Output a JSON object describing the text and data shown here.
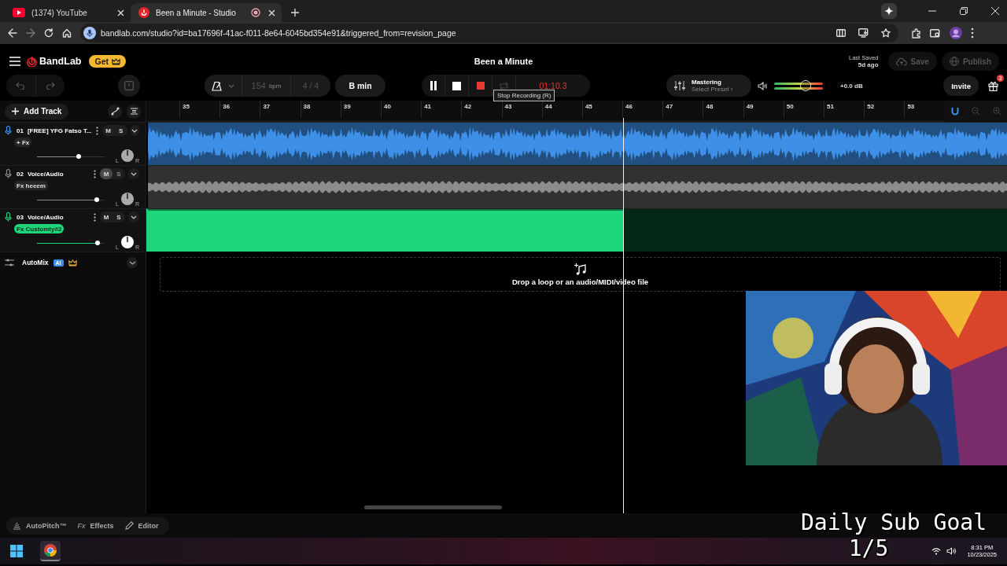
{
  "browser": {
    "tabs": [
      {
        "title": "(1374) YouTube",
        "kind": "video",
        "selected": false,
        "recording": false
      },
      {
        "title": "Been a Minute - Studio",
        "kind": "studio",
        "selected": true,
        "recording": true
      }
    ],
    "url": "bandlab.com/studio?id=ba17696f-41ac-f011-8e64-6045bd354e91&triggered_from=revision_page"
  },
  "app": {
    "logo": "BandLab",
    "get_button": "Get",
    "title": "Been a Minute",
    "last_saved_label": "Last Saved",
    "last_saved_value": "5d ago",
    "save_button": "Save",
    "publish_button": "Publish"
  },
  "toolbar": {
    "bpm": "154",
    "bpm_unit": "bpm",
    "time_signature": "4 / 4",
    "key": "B min",
    "recording": true,
    "time": "01:10.3",
    "tooltip": "Stop Recording (R)",
    "mastering_label": "Mastering",
    "mastering_preset": "Select Preset ›",
    "master_volume": {
      "level": 0.65
    },
    "master_reading": "+0.0 dB",
    "invite_button": "Invite",
    "gift_badge": "3"
  },
  "track_panel": {
    "add_track": "Add Track",
    "tracks": [
      {
        "number": "01",
        "name": "[FREE] YFG Fatso T...",
        "fx": "+ Fx",
        "fx_active": false,
        "mute_label": "M",
        "solo_label": "S",
        "muted": false,
        "selected": false,
        "color": "#3d8fe8",
        "kind": "waveform",
        "volume": {
          "level": 0.62
        },
        "pan_left": "L",
        "pan_right": "R"
      },
      {
        "number": "02",
        "name": "Voice/Audio",
        "fx": "Fx heeem",
        "fx_active": false,
        "mute_label": "M",
        "solo_label": "S",
        "muted": true,
        "selected": false,
        "color": "#8c8c8c",
        "kind": "waveform",
        "volume": {
          "level": 0.88
        },
        "pan_left": "L",
        "pan_right": "R"
      },
      {
        "number": "03",
        "name": "Voice/Audio",
        "fx": "Fx Customty#2",
        "fx_active": true,
        "mute_label": "M",
        "solo_label": "S",
        "muted": false,
        "selected": true,
        "color": "#1ed67a",
        "kind": "recording",
        "volume": {
          "level": 0.89
        },
        "pan_left": "L",
        "pan_right": "R"
      }
    ],
    "automix": {
      "label": "AutoMix",
      "badge": "AI"
    }
  },
  "timeline": {
    "bars": [
      "35",
      "36",
      "37",
      "38",
      "39",
      "40",
      "41",
      "42",
      "43",
      "44",
      "45",
      "46",
      "47",
      "48",
      "49",
      "50",
      "51",
      "52",
      "53"
    ],
    "playhead": {
      "level": 0.554
    },
    "drop_hint": "Drop a loop or an audio/MIDI/video file"
  },
  "bottom_bar": {
    "buttons": [
      {
        "kind": "autopitch",
        "label": "AutoPitch™"
      },
      {
        "kind": "effects",
        "icon_text": "Fx",
        "label": "Effects"
      },
      {
        "kind": "editor",
        "label": "Editor"
      }
    ]
  },
  "overlay": {
    "lines": [
      "Daily Sub Goal",
      "1/5"
    ]
  },
  "taskbar": {
    "time": "8:31 PM",
    "date": "10/23/2025"
  }
}
